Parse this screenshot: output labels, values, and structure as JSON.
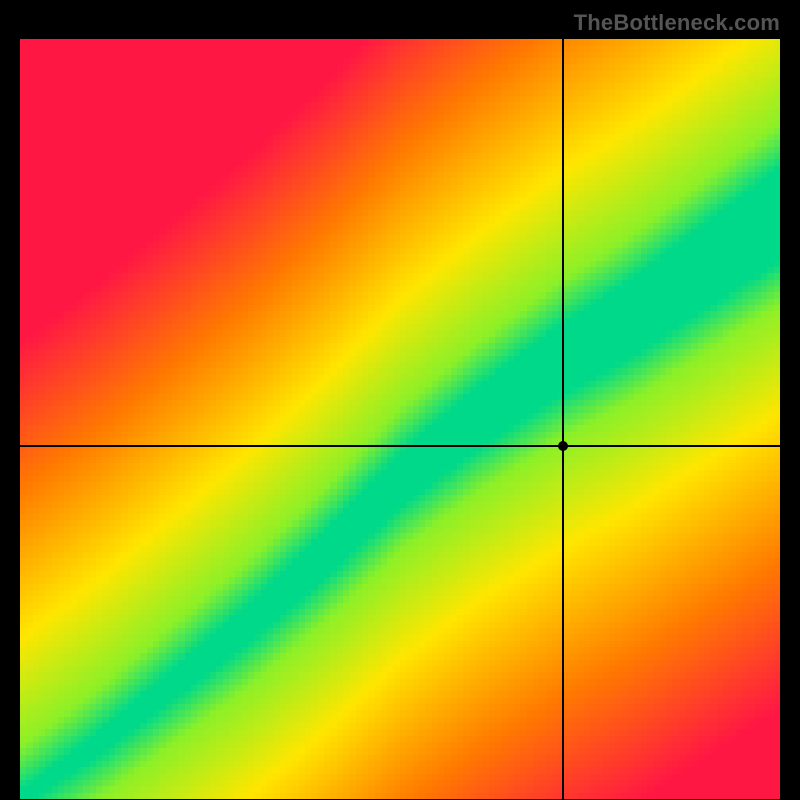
{
  "watermark": "TheBottleneck.com",
  "chart_data": {
    "type": "heatmap",
    "title": "",
    "xlabel": "",
    "ylabel": "",
    "xlim": [
      0,
      1
    ],
    "ylim": [
      0,
      1
    ],
    "grid": false,
    "legend": false,
    "marker": {
      "x": 0.715,
      "y": 0.465
    },
    "crosshair": {
      "x": 0.715,
      "y": 0.465
    },
    "colorscale_note": "value 0 = red, 0.5 = yellow, 1 = green; diagonal optimum band",
    "band": {
      "description": "green optimal band along slightly sub-linear diagonal widening toward top-right",
      "center_curve": [
        [
          0.0,
          0.0
        ],
        [
          0.1,
          0.07
        ],
        [
          0.2,
          0.15
        ],
        [
          0.3,
          0.23
        ],
        [
          0.4,
          0.32
        ],
        [
          0.5,
          0.42
        ],
        [
          0.6,
          0.5
        ],
        [
          0.7,
          0.57
        ],
        [
          0.8,
          0.63
        ],
        [
          0.9,
          0.7
        ],
        [
          1.0,
          0.77
        ]
      ],
      "half_width_start": 0.015,
      "half_width_end": 0.1
    }
  }
}
